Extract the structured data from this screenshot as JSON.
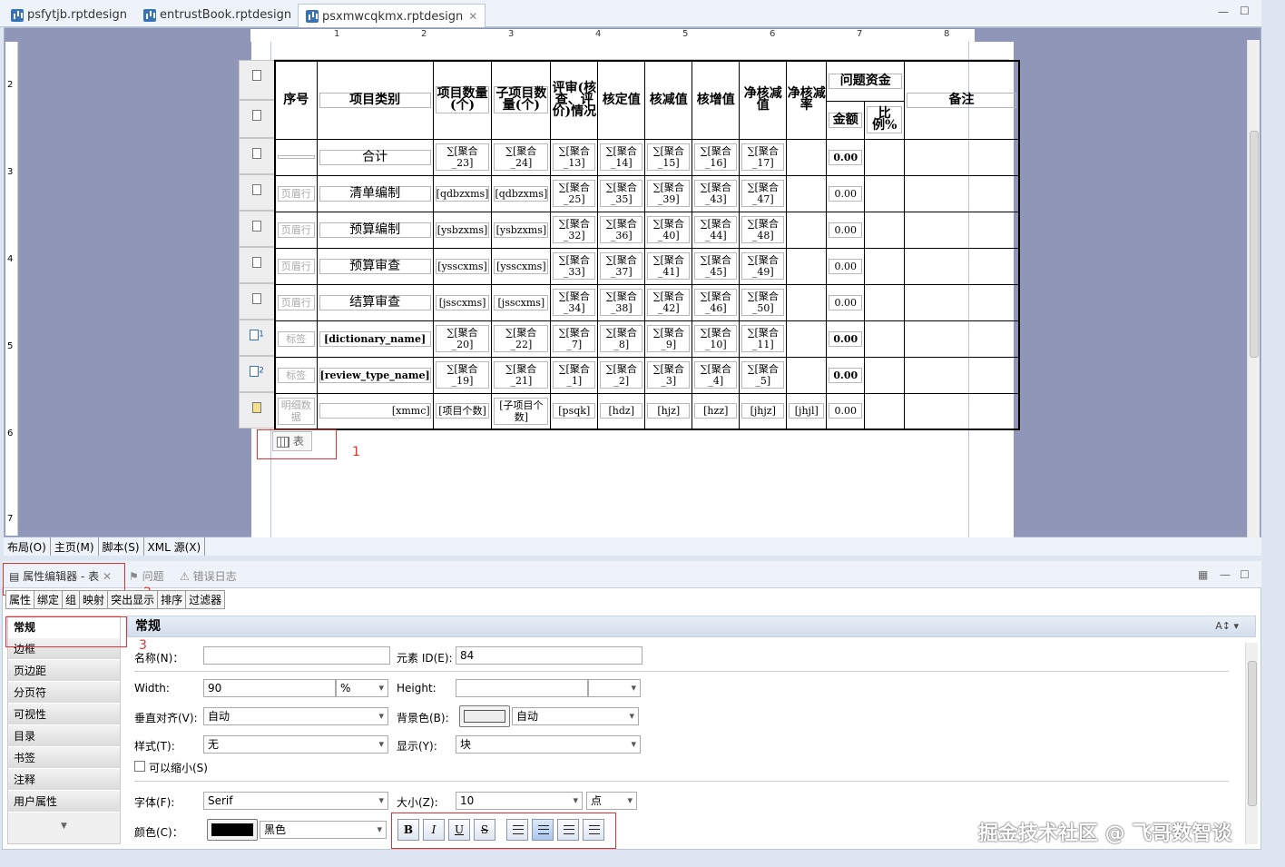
{
  "tabs": [
    "psfytjb.rptdesign",
    "entrustBook.rptdesign",
    "psxmwcqkmx.rptdesign"
  ],
  "ruler": [
    "1",
    "2",
    "3",
    "4",
    "5",
    "6",
    "7",
    "8"
  ],
  "vruler": [
    "2",
    "3",
    "4",
    "5",
    "6",
    "7"
  ],
  "header": {
    "seq": "序号",
    "category": "项目类别",
    "proj_count": "项目数量(个)",
    "sub_count": "子项目数量(个)",
    "review": "评审(核查、评价)情况",
    "hd": "核定值",
    "hj": "核减值",
    "hz": "核增值",
    "jhj": "净核减值",
    "jhjl": "净核减率",
    "problem": "问题资金",
    "amount": "金额",
    "ratio": "比例%",
    "remark": "备注"
  },
  "rows": [
    {
      "label": "合计",
      "gl": "",
      "c1": "∑[聚合_23]",
      "c2": "∑[聚合_24]",
      "c3": "∑[聚合_13]",
      "c4": "∑[聚合_14]",
      "c5": "∑[聚合_15]",
      "c6": "∑[聚合_16]",
      "c7": "∑[聚合_17]",
      "amt": "0.00"
    },
    {
      "label": "清单编制",
      "gl": "页眉行",
      "c1": "[qdbzxms]",
      "c2": "[qdbzxms]",
      "c3": "∑[聚合_25]",
      "c4": "∑[聚合_35]",
      "c5": "∑[聚合_39]",
      "c6": "∑[聚合_43]",
      "c7": "∑[聚合_47]",
      "amt": "0.00"
    },
    {
      "label": "预算编制",
      "gl": "页眉行",
      "c1": "[ysbzxms]",
      "c2": "[ysbzxms]",
      "c3": "∑[聚合_32]",
      "c4": "∑[聚合_36]",
      "c5": "∑[聚合_40]",
      "c6": "∑[聚合_44]",
      "c7": "∑[聚合_48]",
      "amt": "0.00"
    },
    {
      "label": "预算审查",
      "gl": "页眉行",
      "c1": "[ysscxms]",
      "c2": "[ysscxms]",
      "c3": "∑[聚合_33]",
      "c4": "∑[聚合_37]",
      "c5": "∑[聚合_41]",
      "c6": "∑[聚合_45]",
      "c7": "∑[聚合_49]",
      "amt": "0.00"
    },
    {
      "label": "结算审查",
      "gl": "页眉行",
      "c1": "[jsscxms]",
      "c2": "[jsscxms]",
      "c3": "∑[聚合_34]",
      "c4": "∑[聚合_38]",
      "c5": "∑[聚合_42]",
      "c6": "∑[聚合_46]",
      "c7": "∑[聚合_50]",
      "amt": "0.00"
    },
    {
      "label": "[dictionary_name]",
      "gl": "标签",
      "c1": "∑[聚合_20]",
      "c2": "∑[聚合_22]",
      "c3": "∑[聚合_7]",
      "c4": "∑[聚合_8]",
      "c5": "∑[聚合_9]",
      "c6": "∑[聚合_10]",
      "c7": "∑[聚合_11]",
      "amt": "0.00"
    },
    {
      "label": "[review_type_name]",
      "gl": "标签",
      "c1": "∑[聚合_19]",
      "c2": "∑[聚合_21]",
      "c3": "∑[聚合_1]",
      "c4": "∑[聚合_2]",
      "c5": "∑[聚合_3]",
      "c6": "∑[聚合_4]",
      "c7": "∑[聚合_5]",
      "amt": "0.00"
    },
    {
      "label": "[xmmc]",
      "gl": "明细数据",
      "c1": "[项目个数]",
      "c2": "[子项目个数]",
      "c3": "[psqk]",
      "c4": "[hdz]",
      "c5": "[hjz]",
      "c6": "[hzz]",
      "c7": "[jhjz]",
      "c8": "[jhjl]",
      "amt": "0.00"
    }
  ],
  "gutter": [
    "",
    "",
    "",
    "",
    "",
    "",
    "1",
    "2",
    ""
  ],
  "table_marker": "表",
  "annot": [
    "1",
    "2",
    "3"
  ],
  "bottom_tabs": [
    "布局(O)",
    "主页(M)",
    "脚本(S)",
    "XML 源(X)"
  ],
  "panel": {
    "title": "属性编辑器 - 表",
    "problems": "问题",
    "errlog": "错误日志"
  },
  "subtabs": [
    "属性",
    "绑定",
    "组",
    "映射",
    "突出显示",
    "排序",
    "过滤器"
  ],
  "categories": [
    "常规",
    "边框",
    "页边距",
    "分页符",
    "可视性",
    "目录",
    "书签",
    "注释",
    "用户属性"
  ],
  "section": "常规",
  "form": {
    "name_lbl": "名称(N)：",
    "name_val": "",
    "id_lbl": "元素 ID(E):",
    "id_val": "84",
    "width_lbl": "Width:",
    "width_val": "90",
    "width_unit": "%",
    "height_lbl": "Height:",
    "height_val": "",
    "valign_lbl": "垂直对齐(V):",
    "valign_val": "自动",
    "bg_lbl": "背景色(B):",
    "bg_val": "自动",
    "style_lbl": "样式(T):",
    "style_val": "无",
    "display_lbl": "显示(Y):",
    "display_val": "块",
    "shrink_lbl": "可以缩小(S)",
    "font_lbl": "字体(F):",
    "font_val": "Serif",
    "size_lbl": "大小(Z):",
    "size_val": "10",
    "size_unit": "点",
    "color_lbl": "颜色(C)：",
    "color_val": "黑色"
  },
  "fmt": [
    "B",
    "I",
    "U",
    "S"
  ],
  "watermark": "掘金技术社区 @ 飞哥数智谈",
  "colors": {
    "accent": "#3873b8",
    "annot": "#dd3333",
    "canvas": "#8f96b8"
  }
}
